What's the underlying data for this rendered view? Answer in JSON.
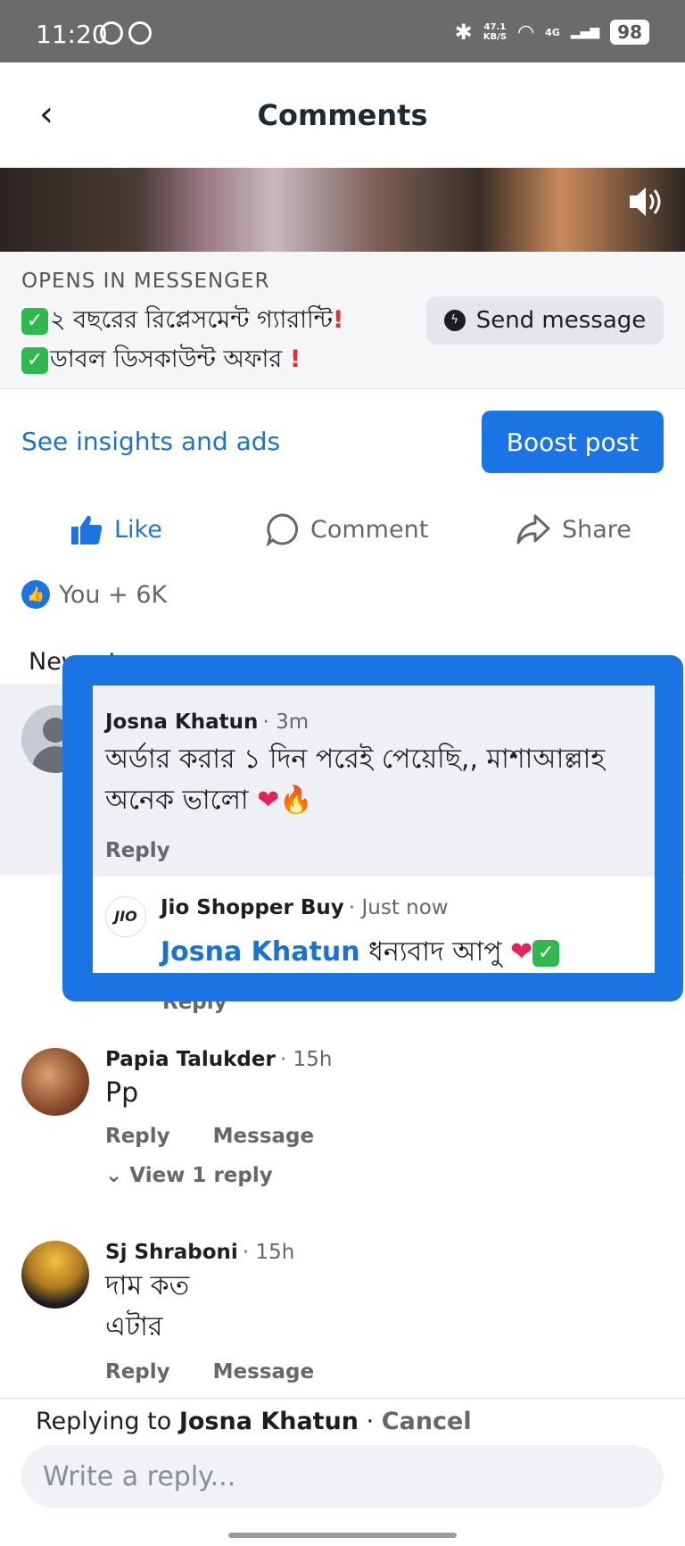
{
  "status_bar": {
    "time": "11:20",
    "speed_value": "47.1",
    "speed_unit": "KB/S",
    "network": "4G",
    "battery": "98"
  },
  "header": {
    "title": "Comments",
    "back_icon": "back-chevron-icon"
  },
  "post": {
    "opens_label": "OPENS IN MESSENGER",
    "promo_line1": "২ বছরের রিপ্লেসমেন্ট গ্যারান্টি",
    "promo_line2": "ডাবল ডিসকাউন্ট অফার ",
    "send_message": "Send message",
    "insights": "See insights and ads",
    "boost": "Boost post",
    "like": "Like",
    "comment": "Comment",
    "share": "Share",
    "reactions": "You + 6K",
    "sort_label": "Newest"
  },
  "highlight_comment": {
    "name": "Josna Khatun",
    "time": "· 3m",
    "text": "অর্ডার করার ১ দিন পরেই পেয়েছি,, মাশাআল্লাহ অনেক ভালো ",
    "reply": "Reply"
  },
  "highlight_reply": {
    "avatar_text": "JIO",
    "name": "Jio Shopper Buy",
    "time": "· Just now",
    "mention": "Josna Khatun",
    "text": " ধন্যবাদ আপু "
  },
  "partial_reply": "Reply",
  "comments": [
    {
      "name": "Papia Talukder",
      "time": "· 15h",
      "text": "Pp",
      "reply": "Reply",
      "message": "Message",
      "view_replies": "View 1 reply"
    },
    {
      "name": "Sj Shraboni",
      "time": "· 15h",
      "text_line1": "দাম কত",
      "text_line2": "এটার",
      "reply": "Reply",
      "message": "Message"
    }
  ],
  "composer": {
    "replying_prefix": "Replying to ",
    "replying_name": "Josna Khatun",
    "separator": " · ",
    "cancel": "Cancel",
    "placeholder": "Write a reply..."
  },
  "colors": {
    "accent": "#1b74e4",
    "link": "#1873d3",
    "highlight_border": "#1b74e4"
  }
}
